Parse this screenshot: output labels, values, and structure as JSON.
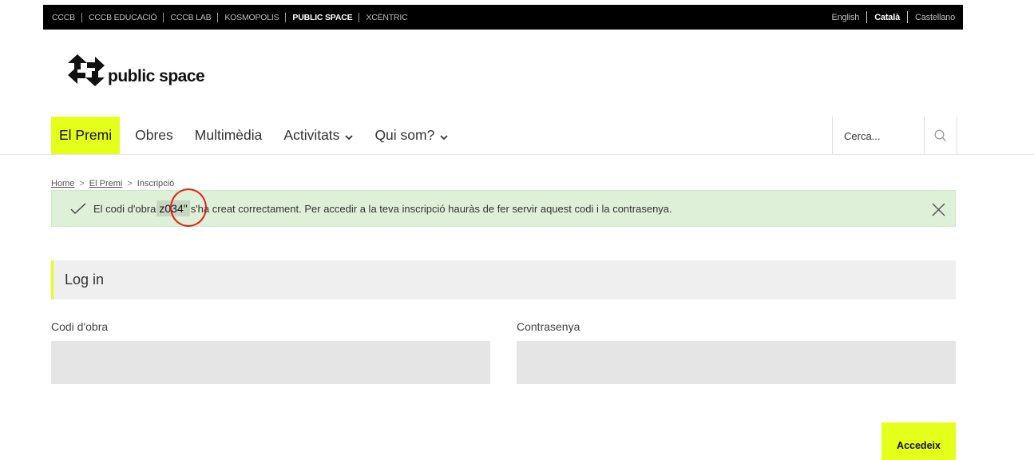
{
  "topbar": {
    "sites": [
      {
        "label": "CCCB",
        "active": false
      },
      {
        "label": "CCCB EDUCACIÓ",
        "active": false
      },
      {
        "label": "CCCB LAB",
        "active": false
      },
      {
        "label": "KOSMOPOLIS",
        "active": false
      },
      {
        "label": "PUBLIC SPACE",
        "active": true
      },
      {
        "label": "XCÈNTRIC",
        "active": false
      }
    ],
    "languages": [
      {
        "label": "English",
        "active": false
      },
      {
        "label": "Català",
        "active": true
      },
      {
        "label": "Castellano",
        "active": false
      }
    ]
  },
  "logo": {
    "text": "public space",
    "icon": "arrows-logo-icon"
  },
  "nav": {
    "items": [
      {
        "label": "El Premi",
        "active": true,
        "dropdown": false
      },
      {
        "label": "Obres",
        "active": false,
        "dropdown": false
      },
      {
        "label": "Multimèdia",
        "active": false,
        "dropdown": false
      },
      {
        "label": "Activitats",
        "active": false,
        "dropdown": true
      },
      {
        "label": "Qui som?",
        "active": false,
        "dropdown": true
      }
    ],
    "search_placeholder": "Cerca...",
    "search_icon": "search-icon"
  },
  "breadcrumb": {
    "items": [
      "Home",
      "El Premi"
    ],
    "current": "Inscripció",
    "separator": ">"
  },
  "alert": {
    "before": "El codi d'obra",
    "code": "z034\"",
    "after": "s'ha creat correctament. Per accedir a la teva inscripció hauràs de fer servir aquest codi i la contrasenya.",
    "icon": "check-icon",
    "close_icon": "close-icon"
  },
  "login": {
    "title": "Log in",
    "code_label": "Codi d'obra",
    "code_value": "",
    "password_label": "Contrasenya",
    "password_value": "",
    "submit_label": "Accedeix"
  },
  "colors": {
    "accent": "#e4ff1a",
    "alert_bg": "#dff0d8",
    "annotation": "#e0201a"
  }
}
